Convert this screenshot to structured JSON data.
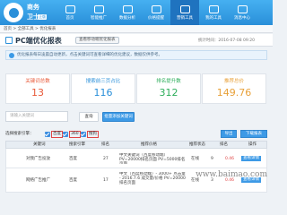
{
  "app": {
    "name_line1": "商务",
    "name_line2": "卫士",
    "version": "正版"
  },
  "nav": [
    {
      "label": "首页"
    },
    {
      "label": "智能推广"
    },
    {
      "label": "数据分析"
    },
    {
      "label": "价格提醒"
    },
    {
      "label": "营销工具"
    },
    {
      "label": "我的工具"
    },
    {
      "label": "消息中心"
    }
  ],
  "breadcrumb": "首页 > 全部工具 > 优化报表",
  "page": {
    "title": "PC端优化报表",
    "pill": "查看移动端优化报表",
    "time": "统计时间：2016-07-08 09:20"
  },
  "notice": "优化报表每日凌晨自动更新，点击关键词可查看详细的优化建议，数据仅供参考。",
  "stats": [
    {
      "label": "关键词总数",
      "value": "13",
      "color": "#e85a3a"
    },
    {
      "label": "搜索前三页占比",
      "value": "116",
      "color": "#2a8fd9"
    },
    {
      "label": "排名提升数",
      "value": "312",
      "color": "#2fae5c"
    },
    {
      "label": "推荐总价",
      "value": "149.76",
      "color": "#e8a13a"
    }
  ],
  "search": {
    "placeholder": "请输入关键词",
    "btn": "查询",
    "btn2": "批量添加关键词"
  },
  "filter": {
    "label": "选择搜索引擎：",
    "options": [
      "百度",
      "360",
      "搜狗"
    ],
    "btn_a": "导出",
    "btn_b": "下载报表"
  },
  "table": {
    "headers": [
      "关键词",
      "搜索引擎",
      "排名",
      "推荐价格",
      "推荐状态",
      "排名",
      "操作"
    ],
    "rows": [
      {
        "keyword": "对我广告投放",
        "engine": "百度",
        "rank": "27",
        "detail": "中文关键词（百度移动端）\n PV=20000排名页面 PV=5000排名页面",
        "status": "在线",
        "rank2": "9",
        "price": "0.46",
        "op": "查看详情"
      },
      {
        "keyword": "网络广告推广",
        "engine": "百度",
        "rank": "17",
        "detail": "中文（百度移动端）- 3000+ 点击量 - 2016.7.6 成交量/价格 PV=20000排名页面",
        "status": "在线",
        "rank2": "3",
        "price": "0.46",
        "op": "查看详情"
      }
    ]
  },
  "watermark": "www.baimao.com"
}
